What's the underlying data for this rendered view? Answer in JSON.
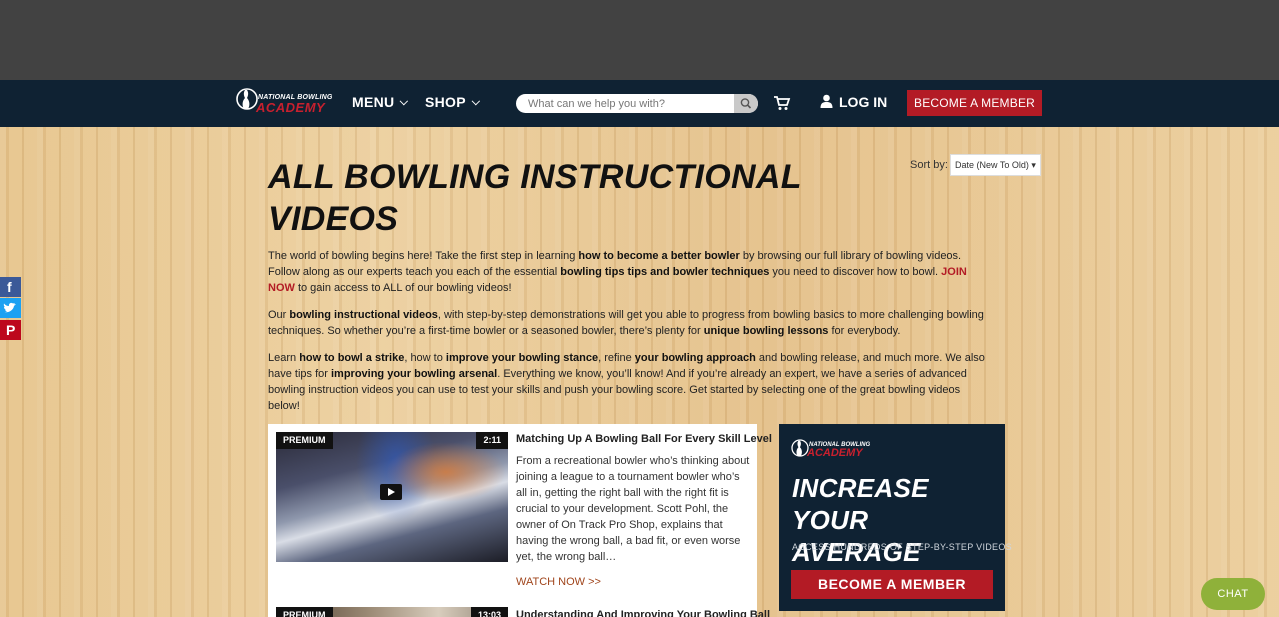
{
  "header": {
    "logo_top": "NATIONAL BOWLING",
    "logo_bottom": "ACADEMY",
    "menu_label": "MENU",
    "shop_label": "SHOP",
    "search_placeholder": "What can we help you with?",
    "login_label": "LOG IN",
    "member_label": "BECOME A MEMBER"
  },
  "page": {
    "title": "ALL BOWLING INSTRUCTIONAL VIDEOS",
    "sort_label": "Sort by:",
    "sort_value": "Date (New To Old)",
    "p1": {
      "a": "The world of bowling begins here! Take the first step in learning ",
      "b1": "how to become a better bowler",
      "c": " by browsing our full library of bowling videos. Follow along as our experts teach you each of the essential ",
      "b2": "bowling tips tips and bowler techniques",
      "d": " you need to discover how to bowl. ",
      "join": "JOIN NOW",
      "e": " to gain access to ALL of our bowling videos!"
    },
    "p2": {
      "a": "Our ",
      "b1": "bowling instructional videos",
      "c": ", with step-by-step demonstrations will get you able to progress from bowling basics to more challenging bowling techniques. So whether you’re a first-time bowler or a seasoned bowler, there’s plenty for ",
      "b2": "unique bowling lessons",
      "d": " for everybody."
    },
    "p3": {
      "a": "Learn ",
      "b1": "how to bowl a strike",
      "c": ", how to ",
      "b2": "improve your bowling stance",
      "d": ", refine ",
      "b3": "your bowling approach",
      "e": " and bowling release, and much more. We also have tips for ",
      "b4": "improving your bowling arsenal",
      "f": ". Everything we know, you’ll know! And if you’re already an expert, we have a series of advanced bowling instruction videos you can use to test your skills and push your bowling score. Get started by selecting one of the great bowling videos below!"
    }
  },
  "social": [
    "f",
    "t",
    "P"
  ],
  "colors": {
    "facebook": "#3b5998",
    "twitter": "#1da1f2",
    "pinterest": "#bd081c",
    "accent": "#b31b25",
    "navy": "#0f2233"
  },
  "videos": [
    {
      "badge": "PREMIUM",
      "duration": "2:11",
      "title": "Matching Up A Bowling Ball For Every Skill Level",
      "description": "From a recreational bowler who’s thinking about joining a league to a tournament bowler who’s all in, getting the right ball with the right fit is crucial to your development. Scott Pohl, the owner of On Track Pro Shop, explains that having the wrong ball, a bad fit, or even worse yet, the wrong ball…",
      "watch": "WATCH NOW >>"
    },
    {
      "badge": "PREMIUM",
      "duration": "13:03",
      "title": "Understanding And Improving Your Bowling Ball"
    }
  ],
  "promo": {
    "logo_top": "NATIONAL BOWLING",
    "logo_bottom": "ACADEMY",
    "headline": "INCREASE YOUR AVERAGE",
    "sub": "ACCESS HUNDREDS OF STEP-BY-STEP VIDEOS",
    "button": "BECOME A MEMBER"
  },
  "chat_label": "CHAT"
}
